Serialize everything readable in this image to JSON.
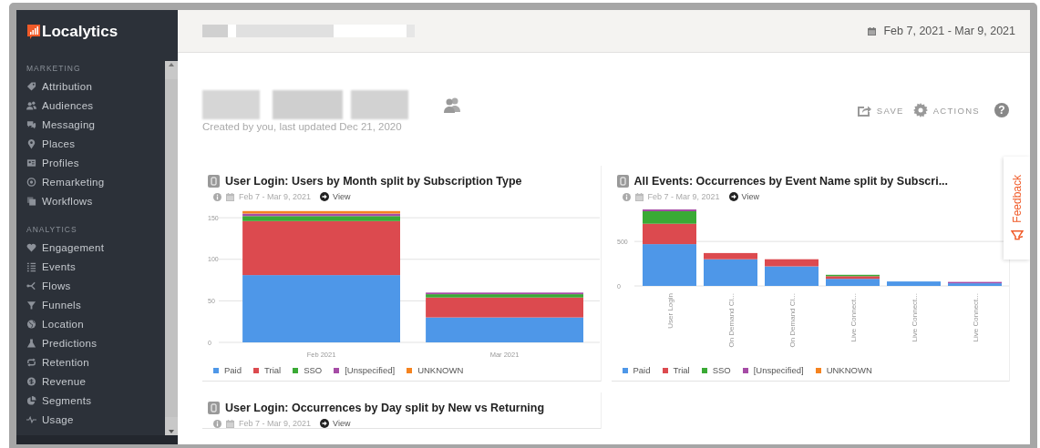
{
  "sidebar": {
    "logo": "Localytics",
    "sections": [
      {
        "heading": "MARKETING",
        "items": [
          {
            "label": "Attribution",
            "selected": false
          },
          {
            "label": "Audiences",
            "selected": false
          },
          {
            "label": "Messaging",
            "selected": false
          },
          {
            "label": "Places",
            "selected": false
          },
          {
            "label": "Profiles",
            "selected": false
          },
          {
            "label": "Remarketing",
            "selected": false
          },
          {
            "label": "Workflows",
            "selected": false
          }
        ]
      },
      {
        "heading": "ANALYTICS",
        "items": [
          {
            "label": "Engagement",
            "selected": false
          },
          {
            "label": "Events",
            "selected": false
          },
          {
            "label": "Flows",
            "selected": false
          },
          {
            "label": "Funnels",
            "selected": false
          },
          {
            "label": "Location",
            "selected": false
          },
          {
            "label": "Predictions",
            "selected": false
          },
          {
            "label": "Retention",
            "selected": false
          },
          {
            "label": "Revenue",
            "selected": false
          },
          {
            "label": "Segments",
            "selected": false
          },
          {
            "label": "Usage",
            "selected": false
          }
        ]
      }
    ]
  },
  "header": {
    "date_range": "Feb 7, 2021 - Mar 9, 2021"
  },
  "dashboard": {
    "subtitle": "Created by you, last updated Dec 21, 2020",
    "save": "SAVE",
    "actions": "ACTIONS",
    "help": "?"
  },
  "cards": [
    {
      "title": "User Login: Users by Month split by Subscription Type",
      "date": "Feb 7 - Mar 9, 2021",
      "view": "View",
      "chart_data": {
        "type": "bar",
        "stacked": true,
        "categories": [
          "Feb 2021",
          "Mar 2021"
        ],
        "ylim": [
          0,
          160
        ],
        "yticks": [
          0,
          50,
          100,
          150
        ],
        "grid": true,
        "series": [
          {
            "name": "Paid",
            "color": "#4e97e8",
            "values": [
              81,
              30
            ]
          },
          {
            "name": "Trial",
            "color": "#dc4a4f",
            "values": [
              65,
              24
            ]
          },
          {
            "name": "SSO",
            "color": "#3aaa35",
            "values": [
              6,
              4
            ]
          },
          {
            "name": "[Unspecified]",
            "color": "#a64ca6",
            "values": [
              3,
              2
            ]
          },
          {
            "name": "UNKNOWN",
            "color": "#f5831f",
            "values": [
              3,
              0
            ]
          }
        ]
      }
    },
    {
      "title": "All Events: Occurrences by Event Name split by Subscri...",
      "date": "Feb 7 - Mar 9, 2021",
      "view": "View",
      "chart_data": {
        "type": "bar",
        "stacked": true,
        "categories": [
          "User Login",
          "On Demand Cl...",
          "On Demand Cl...",
          "Live Connect...",
          "Live Connect...",
          "Live Connect..."
        ],
        "ylim": [
          0,
          860
        ],
        "yticks": [
          0,
          500
        ],
        "grid": true,
        "series": [
          {
            "name": "Paid",
            "color": "#4e97e8",
            "values": [
              470,
              300,
              220,
              80,
              50,
              30
            ]
          },
          {
            "name": "Trial",
            "color": "#dc4a4f",
            "values": [
              230,
              70,
              80,
              30,
              0,
              0
            ]
          },
          {
            "name": "SSO",
            "color": "#3aaa35",
            "values": [
              140,
              0,
              0,
              10,
              0,
              0
            ]
          },
          {
            "name": "[Unspecified]",
            "color": "#a64ca6",
            "values": [
              20,
              0,
              0,
              0,
              0,
              10
            ]
          },
          {
            "name": "UNKNOWN",
            "color": "#f5831f",
            "values": [
              0,
              0,
              0,
              0,
              0,
              0
            ]
          }
        ]
      }
    },
    {
      "title": "User Login: Occurrences by Day split by New vs Returning",
      "date": "Feb 7 - Mar 9, 2021",
      "view": "View"
    }
  ],
  "feedback": "Feedback"
}
